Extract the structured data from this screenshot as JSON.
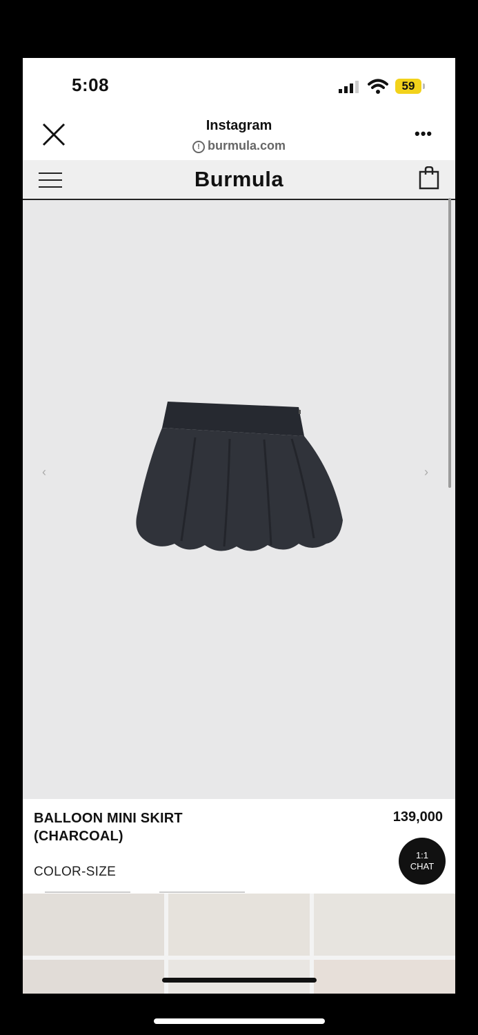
{
  "status_bar": {
    "time": "5:08",
    "battery": "59",
    "icons": [
      "signal-icon",
      "wifi-icon",
      "battery-icon"
    ]
  },
  "browser": {
    "app_name": "Instagram",
    "url": "burmula.com",
    "more_label": "•••"
  },
  "site": {
    "brand": "Burmula"
  },
  "product": {
    "arrow_prev": "‹",
    "arrow_next": "›",
    "name": "BALLOON MINI SKIRT (CHARCOAL)",
    "price": "139,000",
    "option_label": "COLOR-SIZE",
    "image_color": "#2f3137"
  },
  "chat": {
    "line1": "1:1",
    "line2": "CHAT"
  },
  "colors": {
    "battery": "#f2d21b",
    "image_bg": "#e8e8e9",
    "header_bg": "#efefef"
  }
}
